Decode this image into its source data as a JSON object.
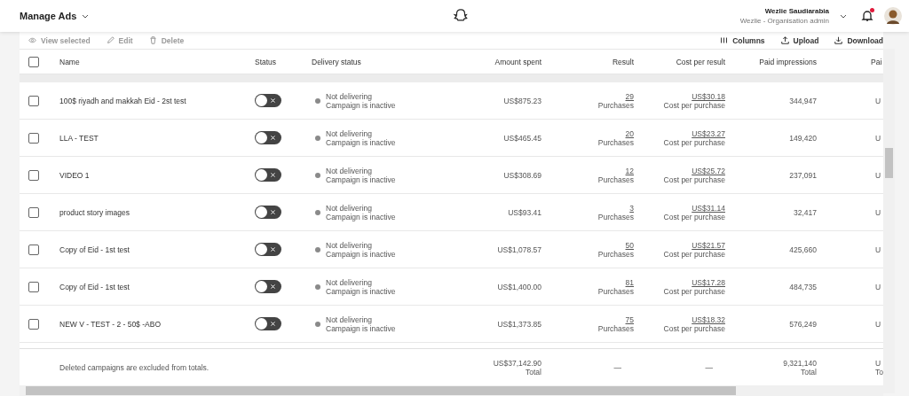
{
  "header": {
    "title": "Manage Ads",
    "user_name": "Wezlie Saudiarabia",
    "user_role": "Wezlie - Organisation admin",
    "notifications_unread": true
  },
  "toolbar": {
    "left": [
      {
        "kind": "view",
        "label": "View selected",
        "disabled": true
      },
      {
        "kind": "edit",
        "label": "Edit",
        "disabled": true
      },
      {
        "kind": "delete",
        "label": "Delete",
        "disabled": true
      }
    ],
    "right": [
      {
        "kind": "columns",
        "label": "Columns",
        "disabled": false
      },
      {
        "kind": "upload",
        "label": "Upload",
        "disabled": false
      },
      {
        "kind": "download",
        "label": "Download",
        "disabled": false
      }
    ]
  },
  "table": {
    "select_all_checked": false,
    "columns": [
      "Name",
      "Status",
      "Delivery status",
      "Amount spent",
      "Result",
      "Cost per result",
      "Paid impressions",
      "Pai"
    ],
    "rows": [
      {
        "name": "100$ riyadh and makkah Eid - 2st test",
        "checked": false,
        "on": false,
        "delivery": "Not delivering",
        "delivery_detail": "Campaign is inactive",
        "amount": "US$875.23",
        "result": "29",
        "result_label": "Purchases",
        "cost": "US$30.18",
        "cost_label": "Cost per purchase",
        "impressions": "344,947",
        "column_9": "U"
      },
      {
        "name": "LLA - TEST",
        "checked": false,
        "on": false,
        "delivery": "Not delivering",
        "delivery_detail": "Campaign is inactive",
        "amount": "US$465.45",
        "result": "20",
        "result_label": "Purchases",
        "cost": "US$23.27",
        "cost_label": "Cost per purchase",
        "impressions": "149,420",
        "column_9": "U"
      },
      {
        "name": "VIDEO 1",
        "checked": false,
        "on": false,
        "delivery": "Not delivering",
        "delivery_detail": "Campaign is inactive",
        "amount": "US$308.69",
        "result": "12",
        "result_label": "Purchases",
        "cost": "US$25.72",
        "cost_label": "Cost per purchase",
        "impressions": "237,091",
        "column_9": "U"
      },
      {
        "name": "product story images",
        "checked": false,
        "on": false,
        "delivery": "Not delivering",
        "delivery_detail": "Campaign is inactive",
        "amount": "US$93.41",
        "result": "3",
        "result_label": "Purchases",
        "cost": "US$31.14",
        "cost_label": "Cost per purchase",
        "impressions": "32,417",
        "column_9": "U"
      },
      {
        "name": "Copy of Eid - 1st test",
        "checked": false,
        "on": false,
        "delivery": "Not delivering",
        "delivery_detail": "Campaign is inactive",
        "amount": "US$1,078.57",
        "result": "50",
        "result_label": "Purchases",
        "cost": "US$21.57",
        "cost_label": "Cost per purchase",
        "impressions": "425,660",
        "column_9": "U"
      },
      {
        "name": "Copy of Eid - 1st test",
        "checked": false,
        "on": false,
        "delivery": "Not delivering",
        "delivery_detail": "Campaign is inactive",
        "amount": "US$1,400.00",
        "result": "81",
        "result_label": "Purchases",
        "cost": "US$17.28",
        "cost_label": "Cost per purchase",
        "impressions": "484,735",
        "column_9": "U"
      },
      {
        "name": "NEW V - TEST - 2 - 50$ -ABO",
        "checked": false,
        "on": false,
        "delivery": "Not delivering",
        "delivery_detail": "Campaign is inactive",
        "amount": "US$1,373.85",
        "result": "75",
        "result_label": "Purchases",
        "cost": "US$18.32",
        "cost_label": "Cost per purchase",
        "impressions": "576,249",
        "column_9": "U"
      }
    ],
    "footer": {
      "note": "Deleted campaigns are excluded from totals.",
      "amount": "US$37,142.90",
      "amount_label": "Total",
      "result": "—",
      "cost": "—",
      "impressions": "9,321,140",
      "impressions_label": "Total",
      "column_9": "U",
      "column_9_label": "To"
    }
  }
}
